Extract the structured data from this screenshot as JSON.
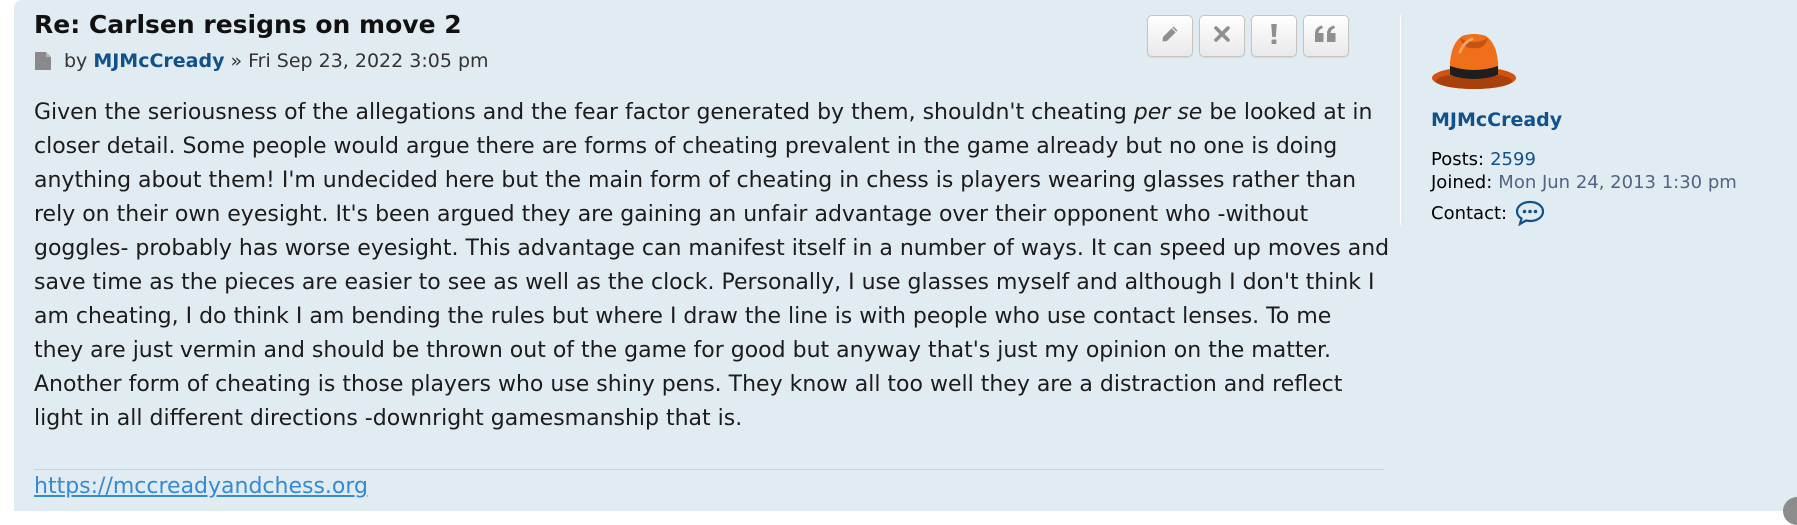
{
  "post": {
    "title": "Re: Carlsen resigns on move 2",
    "by_label": "by",
    "author": "MJMcCready",
    "separator": "»",
    "date": "Fri Sep 23, 2022 3:05 pm",
    "content_lines": [
      {
        "before": "Given the seriousness of the allegations and the fear factor generated by them, shouldn't cheating ",
        "em": "per se",
        "after": " be looked at in"
      },
      {
        "text": "closer detail. Some people would argue there are forms of cheating prevalent in the game already but no one is doing"
      },
      {
        "text": "anything about them! I'm undecided here but the main form of cheating in chess is players wearing glasses rather than"
      },
      {
        "text": "rely on their own eyesight. It's been argued they are gaining an unfair advantage over their opponent who -without"
      },
      {
        "text": "goggles- probably has worse eyesight. This advantage can manifest itself in a number of ways. It can speed up moves and"
      },
      {
        "text": "save time as the pieces are easier to see as well as the clock. Personally, I use glasses myself and although I don't think I"
      },
      {
        "text": "am cheating, I do think I am bending the rules but where I draw the line is with people who use contact lenses. To me"
      },
      {
        "text": "they are just vermin and should be thrown out of the game for good but anyway that's just my opinion on the matter."
      },
      {
        "text": "Another form of cheating is those players who use shiny pens. They know all too well they are a distraction and reflect"
      },
      {
        "text": "light in all different directions -downright gamesmanship that is."
      }
    ],
    "signature_link": "https://mccreadyandchess.org",
    "buttons": [
      {
        "name": "edit-button",
        "icon": "pencil-icon"
      },
      {
        "name": "delete-button",
        "icon": "close-icon"
      },
      {
        "name": "report-button",
        "icon": "exclamation-icon"
      },
      {
        "name": "quote-button",
        "icon": "quote-icon"
      }
    ]
  },
  "profile": {
    "avatar_icon": "orange-fedora-hat-avatar",
    "username": "MJMcCready",
    "posts_label": "Posts:",
    "posts_value": "2599",
    "joined_label": "Joined:",
    "joined_value": "Mon Jun 24, 2013 1:30 pm",
    "contact_label": "Contact:",
    "contact_icon": "speech-bubble-icon"
  },
  "colors": {
    "post_background": "#e1ebf2",
    "link": "#105289",
    "signature_link": "#368ad2",
    "button_icon": "#8f8f8f"
  }
}
